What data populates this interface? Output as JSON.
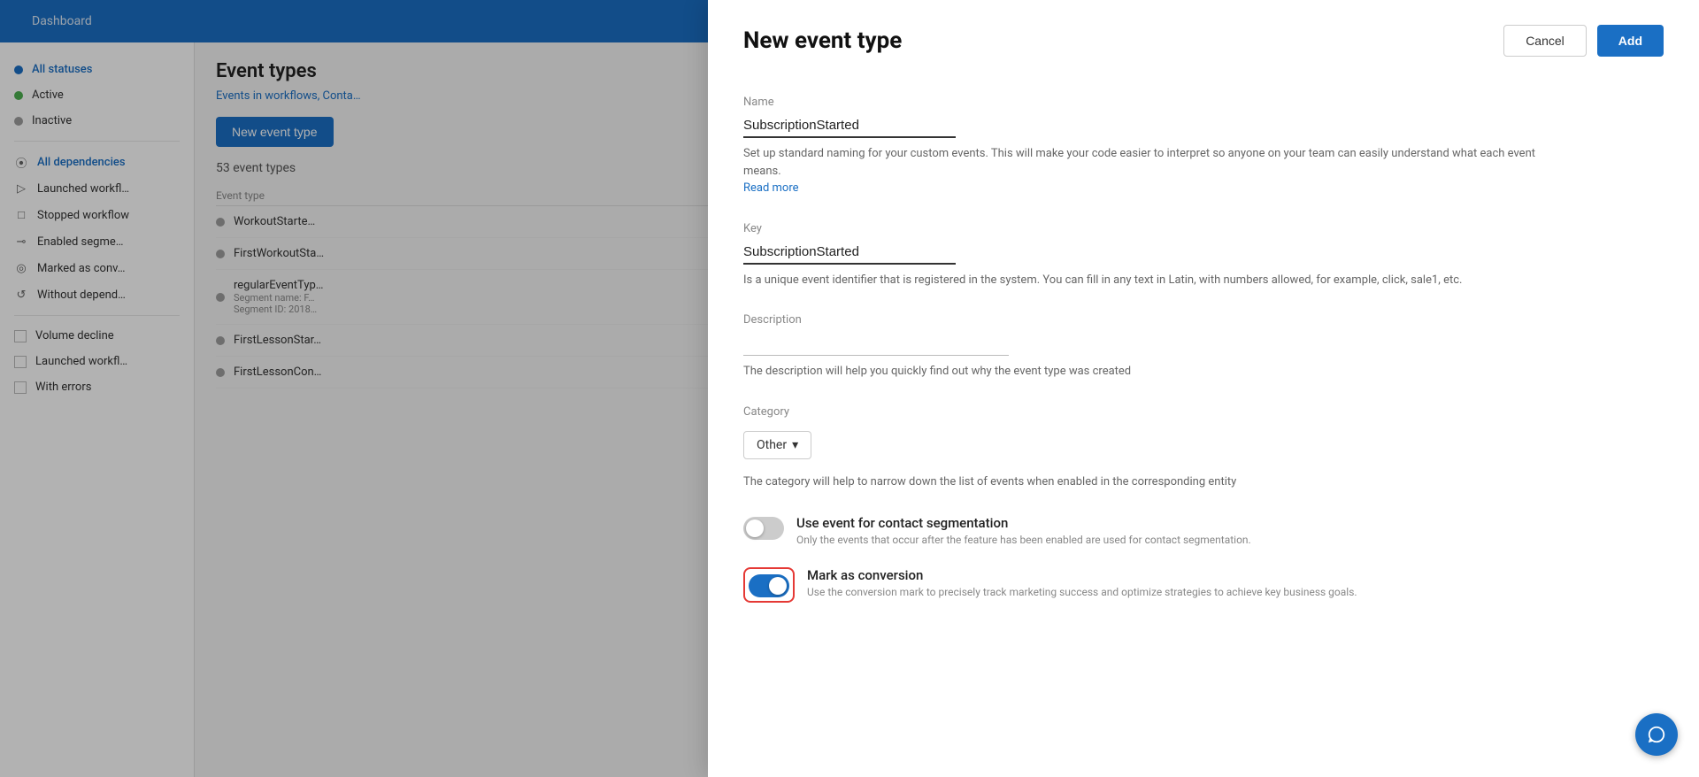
{
  "topNav": {
    "items": [
      "Dashboard"
    ]
  },
  "sidebar": {
    "statusSection": {
      "items": [
        {
          "id": "all-statuses",
          "label": "All statuses",
          "dotClass": "dot-blue",
          "active": true
        },
        {
          "id": "active",
          "label": "Active",
          "dotClass": "dot-green"
        },
        {
          "id": "inactive",
          "label": "Inactive",
          "dotClass": "dot-gray"
        }
      ]
    },
    "dependencySection": {
      "items": [
        {
          "id": "all-dependencies",
          "label": "All dependencies",
          "icon": "⦿",
          "active": true
        },
        {
          "id": "launched-workflow",
          "label": "Launched workfl…",
          "icon": "▷"
        },
        {
          "id": "stopped-workflow",
          "label": "Stopped workflow",
          "icon": "□"
        },
        {
          "id": "enabled-segment",
          "label": "Enabled segme…",
          "icon": "⊸"
        },
        {
          "id": "marked-conversion",
          "label": "Marked as conv…",
          "icon": "◎"
        },
        {
          "id": "without-dependency",
          "label": "Without depend…",
          "icon": "↺"
        }
      ]
    },
    "checkboxSection": {
      "items": [
        {
          "id": "volume-decline",
          "label": "Volume decline"
        },
        {
          "id": "launched-workflow2",
          "label": "Launched workfl…"
        },
        {
          "id": "with-errors",
          "label": "With errors"
        }
      ]
    }
  },
  "mainContent": {
    "title": "Event types",
    "subtitle": "Events in workflows, Conta…",
    "buttonLabel": "New event type",
    "count": "53  event types",
    "tableHeader": "Event type",
    "rows": [
      {
        "name": "WorkoutStarte…"
      },
      {
        "name": "FirstWorkoutSta…"
      },
      {
        "name": "regularEventTyp…",
        "sub1": "Segment name: F…",
        "sub2": "Segment ID: 2018…"
      },
      {
        "name": "FirstLessonStar…"
      },
      {
        "name": "FirstLessonCon…"
      }
    ]
  },
  "modal": {
    "title": "New event type",
    "cancelLabel": "Cancel",
    "addLabel": "Add",
    "nameSection": {
      "label": "Name",
      "value": "SubscriptionStarted",
      "hint": "Set up standard naming for your custom events. This will make your code easier to interpret so anyone on your team can easily understand what each event means.",
      "readMoreLabel": "Read more"
    },
    "keySection": {
      "label": "Key",
      "value": "SubscriptionStarted",
      "hint": "Is a unique event identifier that is registered in the system. You can fill in any text in Latin, with numbers allowed, for example, click, sale1, etc."
    },
    "descriptionSection": {
      "label": "Description",
      "value": "",
      "placeholder": "",
      "hint": "The description will help you quickly find out why the event type was created"
    },
    "categorySection": {
      "label": "Category",
      "value": "Other",
      "hint": "The category will help to narrow down the list of events when enabled in the corresponding entity"
    },
    "segmentationToggle": {
      "label": "Use event for contact segmentation",
      "hint": "Only the events that occur after the feature has been enabled are used for contact segmentation.",
      "on": false
    },
    "conversionToggle": {
      "label": "Mark as conversion",
      "hint": "Use the conversion mark to precisely track marketing success and optimize strategies to achieve key business goals.",
      "on": true
    }
  }
}
